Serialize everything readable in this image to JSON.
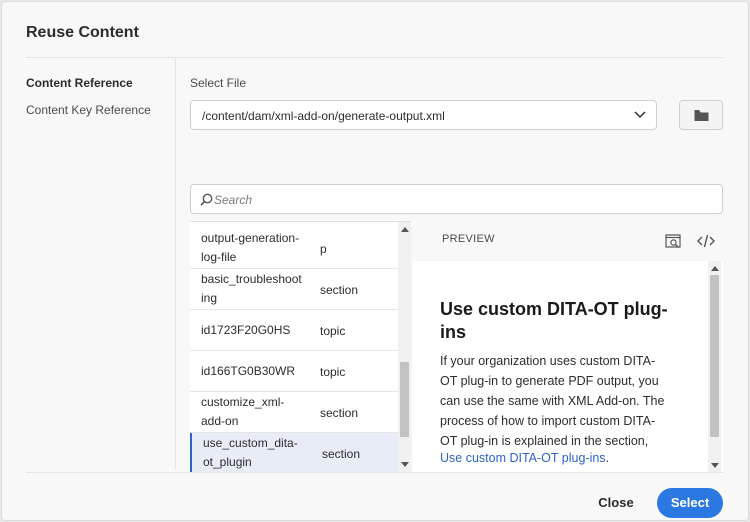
{
  "dialog": {
    "title": "Reuse Content"
  },
  "nav": [
    {
      "label": "Content Reference",
      "active": true
    },
    {
      "label": "Content Key Reference",
      "active": false
    }
  ],
  "select_file": {
    "label": "Select File",
    "path": "/content/dam/xml-add-on/generate-output.xml"
  },
  "search": {
    "placeholder": "Search"
  },
  "list": {
    "rows": [
      {
        "name_lines": [
          "output-generation-",
          "log-file"
        ],
        "type": "p",
        "selected": false
      },
      {
        "name_lines": [
          "basic_troubleshoot",
          "ing"
        ],
        "type": "section",
        "selected": false
      },
      {
        "name_lines": [
          "id1723F20G0HS"
        ],
        "type": "topic",
        "selected": false
      },
      {
        "name_lines": [
          "id166TG0B30WR"
        ],
        "type": "topic",
        "selected": false
      },
      {
        "name_lines": [
          "customize_xml-",
          "add-on"
        ],
        "type": "section",
        "selected": false
      },
      {
        "name_lines": [
          "use_custom_dita-",
          "ot_plugin"
        ],
        "type": "section",
        "selected": true
      }
    ],
    "scroll_position": 0.85
  },
  "preview": {
    "label": "PREVIEW",
    "title_lines": [
      "Use custom DITA-OT plug-",
      "ins"
    ],
    "body_lines": [
      "If your organization uses custom DITA-",
      "OT plug-in to generate PDF output, you",
      "can use the same with XML Add-on. The",
      "process of how to import custom DITA-",
      "OT plug-in is explained in the section,"
    ],
    "link_text": "Use custom DITA-OT plug-ins",
    "link_suffix": ".",
    "scroll_position": 0.0
  },
  "footer": {
    "close_label": "Close",
    "select_label": "Select"
  },
  "colors": {
    "accent": "#2c78e2",
    "link": "#2d64c9",
    "selected_row": "#e8ecf7"
  },
  "icons": {
    "path_dropdown": "chevron-down-icon",
    "browse": "folder-icon",
    "search": "search-icon",
    "preview_zoom": "preview-search-icon",
    "code_view": "code-icon"
  }
}
